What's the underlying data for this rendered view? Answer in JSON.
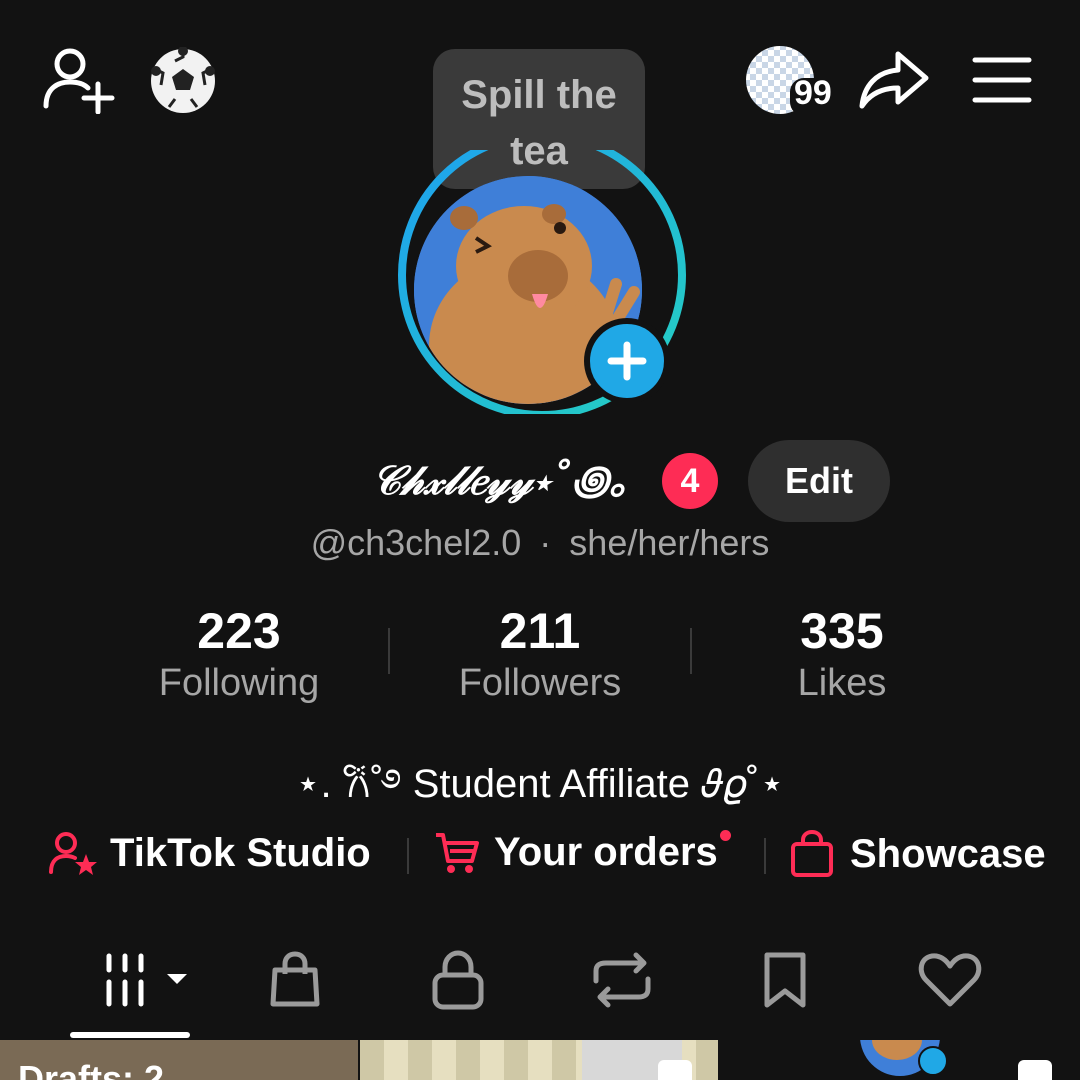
{
  "topbar": {
    "tooltip": "Spill the tea",
    "story_count": "99"
  },
  "profile": {
    "display_name": "𝒞𝒽𝓍𝓁𝓁𝑒𝓎𝓎⋆˚꩜｡",
    "notification_count": "4",
    "edit_label": "Edit",
    "handle": "@ch3chel2.0",
    "separator": "·",
    "pronouns": "she/her/hers",
    "bio": "⋆. 𐙚˚࿔ Student Affiliate 𝜗𝜚˚⋆"
  },
  "stats": [
    {
      "value": "223",
      "label": "Following"
    },
    {
      "value": "211",
      "label": "Followers"
    },
    {
      "value": "335",
      "label": "Likes"
    }
  ],
  "links": [
    {
      "label": "TikTok Studio",
      "icon": "user-star-icon"
    },
    {
      "label": "Your orders",
      "icon": "cart-icon"
    },
    {
      "label": "Showcase",
      "icon": "shopping-bag-icon"
    }
  ],
  "tabs": [
    "videos-grid-icon",
    "shop-bag-icon",
    "lock-icon",
    "repost-icon",
    "bookmark-icon",
    "heart-icon"
  ],
  "grid": {
    "drafts_label": "Drafts: 2"
  },
  "colors": {
    "accent": "#fe2c55",
    "blue": "#20a8e6",
    "ring_start": "#1ea0f0",
    "ring_end": "#25d0c0"
  }
}
